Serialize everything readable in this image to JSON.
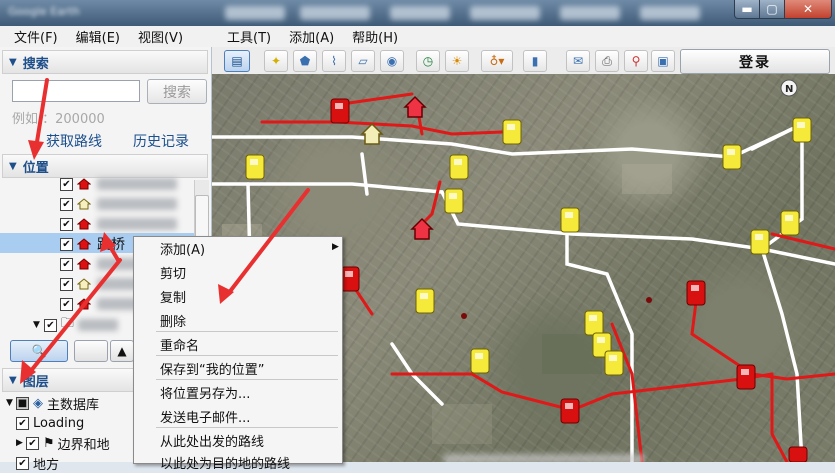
{
  "window": {
    "title": "Google Earth",
    "controls": {
      "min": "▬",
      "max": "▢",
      "close": "✕"
    }
  },
  "menubar": [
    {
      "label": "文件(F)"
    },
    {
      "label": "编辑(E)"
    },
    {
      "label": "视图(V)"
    },
    {
      "label": "工具(T)"
    },
    {
      "label": "添加(A)"
    },
    {
      "label": "帮助(H)"
    }
  ],
  "search": {
    "header": "搜索",
    "button": "搜索",
    "example": "例如 ：200000",
    "get_route": "获取路线",
    "history": "历史记录"
  },
  "places": {
    "header": "位置",
    "selected_label": "路桥"
  },
  "layers": {
    "header": "图层",
    "items": [
      "主数据库",
      "Loading",
      "边界和地",
      "地方"
    ]
  },
  "toolbar": {
    "login": "登录"
  },
  "context_menu": {
    "items": [
      "添加(A)",
      "剪切",
      "复制",
      "删除",
      "重命名",
      "保存到“我的位置”",
      "将位置另存为...",
      "发送电子邮件...",
      "从此处出发的路线",
      "以此处为目的地的路线"
    ]
  },
  "map": {
    "compass": "N"
  },
  "colors": {
    "route_red": "#e01818",
    "road_white": "#ffffff",
    "pin_yellow": "#f5ea3a",
    "pin_red": "#d81010",
    "annotation_arrow": "#e83030"
  }
}
